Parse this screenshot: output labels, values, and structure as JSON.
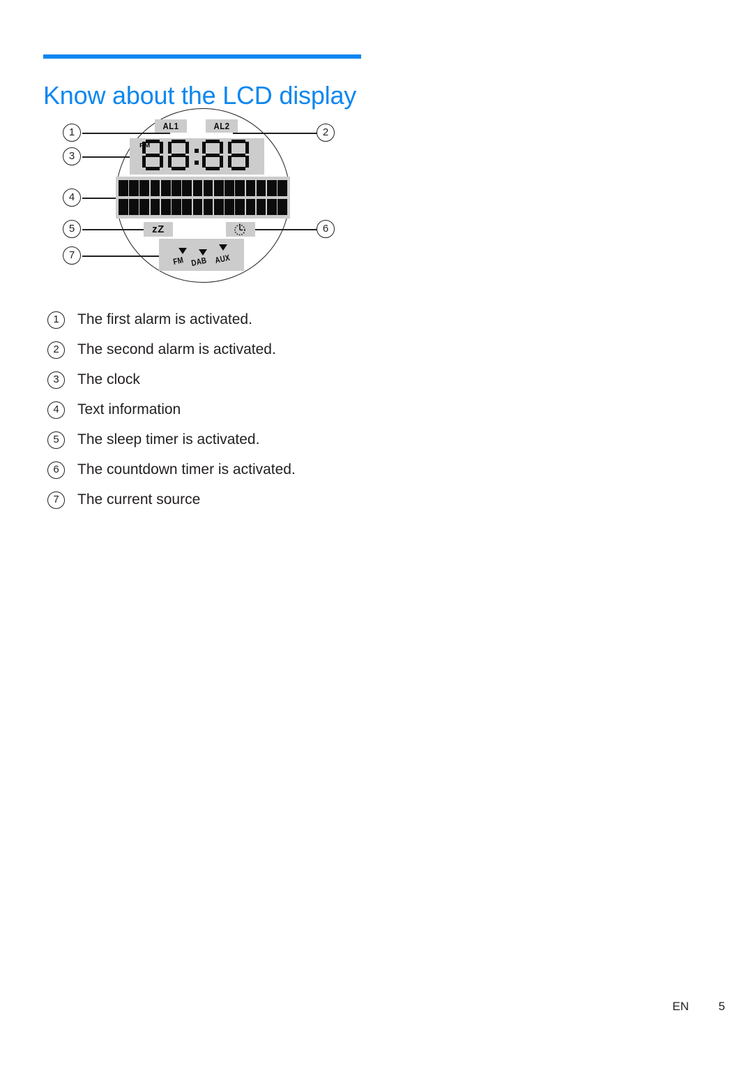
{
  "document": {
    "title": "Know about the LCD display",
    "accent_color": "#0d87ef",
    "rule_color": "#0b87ee"
  },
  "diagram": {
    "name": "lcd-display-diagram",
    "lcd": {
      "alarm1": {
        "label": "AL1",
        "icon": "alarm-one-indicator"
      },
      "alarm2": {
        "label": "AL2",
        "icon": "alarm-two-indicator"
      },
      "clock": {
        "pm_indicator": "PM",
        "display_value": "88:88",
        "digits": [
          "8",
          "8",
          "8",
          "8"
        ],
        "separator": ":"
      },
      "text_information": {
        "rows": 2,
        "cells_per_row": 16
      },
      "sleep_timer": {
        "label": "zZ",
        "icon": "sleep-zz-icon"
      },
      "countdown_timer": {
        "label": "",
        "icon": "countdown-clock-icon"
      },
      "sources": [
        {
          "label": "FM",
          "icon": "source-pointer-icon"
        },
        {
          "label": "DAB",
          "icon": "source-pointer-icon"
        },
        {
          "label": "AUX",
          "icon": "source-pointer-icon"
        }
      ]
    },
    "callouts": [
      {
        "number": "1",
        "side": "left"
      },
      {
        "number": "2",
        "side": "right"
      },
      {
        "number": "3",
        "side": "left"
      },
      {
        "number": "4",
        "side": "left"
      },
      {
        "number": "5",
        "side": "left"
      },
      {
        "number": "6",
        "side": "right"
      },
      {
        "number": "7",
        "side": "left"
      }
    ]
  },
  "legend": [
    {
      "number": "1",
      "text": "The first alarm is activated."
    },
    {
      "number": "2",
      "text": "The second alarm is activated."
    },
    {
      "number": "3",
      "text": "The clock"
    },
    {
      "number": "4",
      "text": "Text information"
    },
    {
      "number": "5",
      "text": "The sleep timer is activated."
    },
    {
      "number": "6",
      "text": "The countdown timer is activated."
    },
    {
      "number": "7",
      "text": "The current source"
    }
  ],
  "footer": {
    "language": "EN",
    "page_number": "5"
  }
}
